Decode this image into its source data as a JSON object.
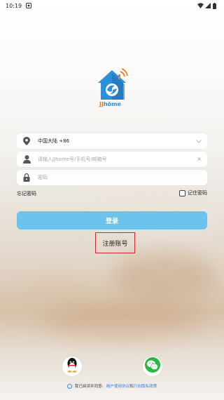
{
  "status_bar": {
    "time": "10:19",
    "notification_icon": "sync-icon",
    "right_icons": [
      "wifi-icon",
      "signal-icon",
      "battery-icon"
    ]
  },
  "logo": {
    "text_jj": "JJ",
    "text_home": "hōme",
    "colors": {
      "roof": "#2d8fd8",
      "accent": "#f07a1e",
      "body": "#1f78c8"
    }
  },
  "form": {
    "region": {
      "label": "中国大陆 +86",
      "icon": "location-pin-icon",
      "chevron": "chevron-down-icon"
    },
    "username": {
      "placeholder": "请输入JJhome号/手机号/邮箱号",
      "icon": "user-icon",
      "clear": "×"
    },
    "password": {
      "placeholder": "密码",
      "icon": "lock-icon"
    },
    "forgot_password": "忘记密码",
    "remember_password": "记住密码"
  },
  "login_button": "登录",
  "register_link": "注册账号",
  "social": {
    "qq": "qq-icon",
    "wechat": "wechat-icon"
  },
  "agreement": {
    "prefix": "我已阅读并同意:",
    "terms": "用户使用协议",
    "and": "和",
    "privacy": "万向隐私政策"
  },
  "colors": {
    "primary_button": "#6cc3ec",
    "link": "#2c7fe0",
    "highlight_box": "#d9262e"
  }
}
